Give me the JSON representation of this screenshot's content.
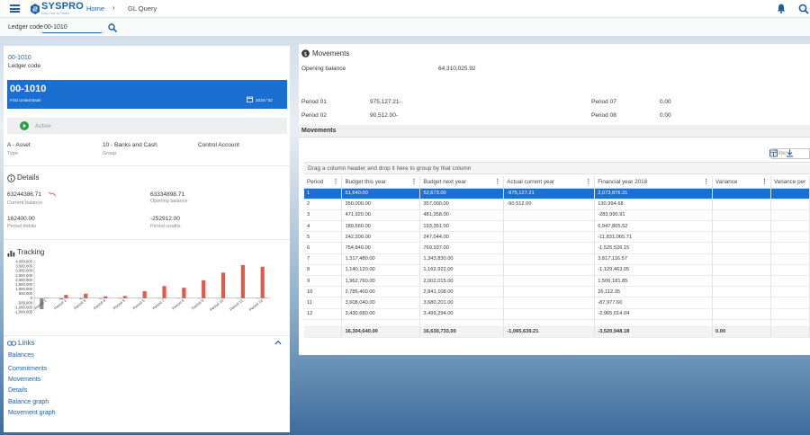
{
  "topbar": {
    "brand": "SYSPRO",
    "brand_tagline": "Easy Your so Rated",
    "breadcrumb_home": "Home",
    "breadcrumb_separator": "›",
    "breadcrumb_page": "GL Query"
  },
  "ledger": {
    "label": "Ledger code",
    "value": "00-1010"
  },
  "account": {
    "code_link": "00-1010",
    "code_caption": "Ledger code",
    "card_title": "00-1010",
    "card_subtitle": "First United Bank",
    "card_date": "2018 / 02",
    "status": "Active",
    "type_value": "A - Asset",
    "type_label": "Type",
    "group_value": "10 - Banks and Cash",
    "group_label": "Group",
    "control_value": "Control Account"
  },
  "details": {
    "heading": "Details",
    "current_balance": "63244386.71",
    "current_balance_label": "Current balance",
    "opening_balance": "63334898.71",
    "opening_balance_label": "Opening balance",
    "period_debits": "162400.00",
    "period_debits_label": "Period debits",
    "period_credits": "-252912.00",
    "period_credits_label": "Period credits"
  },
  "tracking": {
    "heading": "Tracking"
  },
  "chart_data": {
    "type": "bar",
    "title": "",
    "xlabel": "",
    "ylabel": "",
    "ylim": [
      -1500000,
      4000000
    ],
    "yticks": [
      "4,000,000",
      "3,500,000",
      "3,000,000",
      "2,500,000",
      "2,000,000",
      "1,500,000",
      "1,000,000",
      "500,000",
      "0",
      "-500,000",
      "-1,000,000",
      "-1,500,000"
    ],
    "categories": [
      "Period 1",
      "Period 2",
      "Period 3",
      "Period 4",
      "Period 5",
      "Period 6",
      "Period 7",
      "Period 8",
      "Period 9",
      "Period 10",
      "Period 11",
      "Period 12"
    ],
    "series": [
      {
        "color": "#8a8a8a",
        "values": [
          -1200000,
          -150000,
          -100000,
          -80000,
          -60000,
          -50000,
          -50000,
          -50000,
          -50000,
          -50000,
          -50000,
          -50000
        ]
      },
      {
        "color": "#e05a4a",
        "values": [
          50000,
          350000,
          480000,
          190000,
          240000,
          755000,
          1320000,
          1140000,
          1960000,
          2790000,
          3610000,
          3430000
        ]
      }
    ]
  },
  "links": {
    "heading": "Links",
    "items": [
      "Balances",
      "Commitments",
      "Movements",
      "Details",
      "Balance graph",
      "Movement graph"
    ]
  },
  "movements_summary": {
    "title": "Movements",
    "opening_label": "Opening balance",
    "opening_value": "64,310,025.92",
    "p01_label": "Period 01",
    "p01_value": "975,127.21-",
    "p02_label": "Period 02",
    "p02_value": "90,512.00-",
    "p07_label": "Period 07",
    "p07_value": "0.00",
    "p08_label": "Period 08",
    "p08_value": "0.00"
  },
  "grid": {
    "window_title": "Movements",
    "filter_placeholder": "Filter",
    "group_hint": "Drag a column header and drop it here to group by that column",
    "columns": [
      "Period",
      "Budget this year",
      "Budget next year",
      "Actual current year",
      "Financial year 2018",
      "Variance",
      "Variance per"
    ],
    "rows": [
      [
        "1",
        "51,640.00",
        "52,673.00",
        "-975,127.21",
        "2,073,876.31",
        "",
        ""
      ],
      [
        "2",
        "350,000.00",
        "357,000.00",
        "-90,512.00",
        "130,994.68",
        "",
        ""
      ],
      [
        "3",
        "471,920.00",
        "481,358.00",
        "",
        "-283,990.91",
        "",
        ""
      ],
      [
        "4",
        "189,560.00",
        "193,351.00",
        "",
        "6,947,805.52",
        "",
        ""
      ],
      [
        "5",
        "242,200.00",
        "247,044.00",
        "",
        "-11,831,065.71",
        "",
        ""
      ],
      [
        "6",
        "754,840.00",
        "769,937.00",
        "",
        "-1,525,526.15",
        "",
        ""
      ],
      [
        "7",
        "1,317,480.00",
        "1,343,830.00",
        "",
        "3,817,116.57",
        "",
        ""
      ],
      [
        "8",
        "1,140,120.00",
        "1,162,922.00",
        "",
        "-1,129,463.05",
        "",
        ""
      ],
      [
        "9",
        "1,962,760.00",
        "2,002,015.00",
        "",
        "1,506,181.85",
        "",
        ""
      ],
      [
        "10",
        "2,785,400.00",
        "2,841,108.00",
        "",
        "26,112.35",
        "",
        ""
      ],
      [
        "11",
        "3,608,040.00",
        "3,680,201.00",
        "",
        "-87,977.60",
        "",
        ""
      ],
      [
        "12",
        "3,430,680.00",
        "3,499,294.00",
        "",
        "-2,965,014.04",
        "",
        ""
      ]
    ],
    "totals": [
      "",
      "16,304,640.00",
      "16,630,733.00",
      "-1,065,639.21",
      "-3,520,948.18",
      "0.00",
      ""
    ]
  },
  "colors": {
    "accent": "#1a6fd1",
    "brand": "#1d5fa8",
    "bar_positive": "#e05a4a",
    "bar_negative": "#8a8a8a"
  }
}
